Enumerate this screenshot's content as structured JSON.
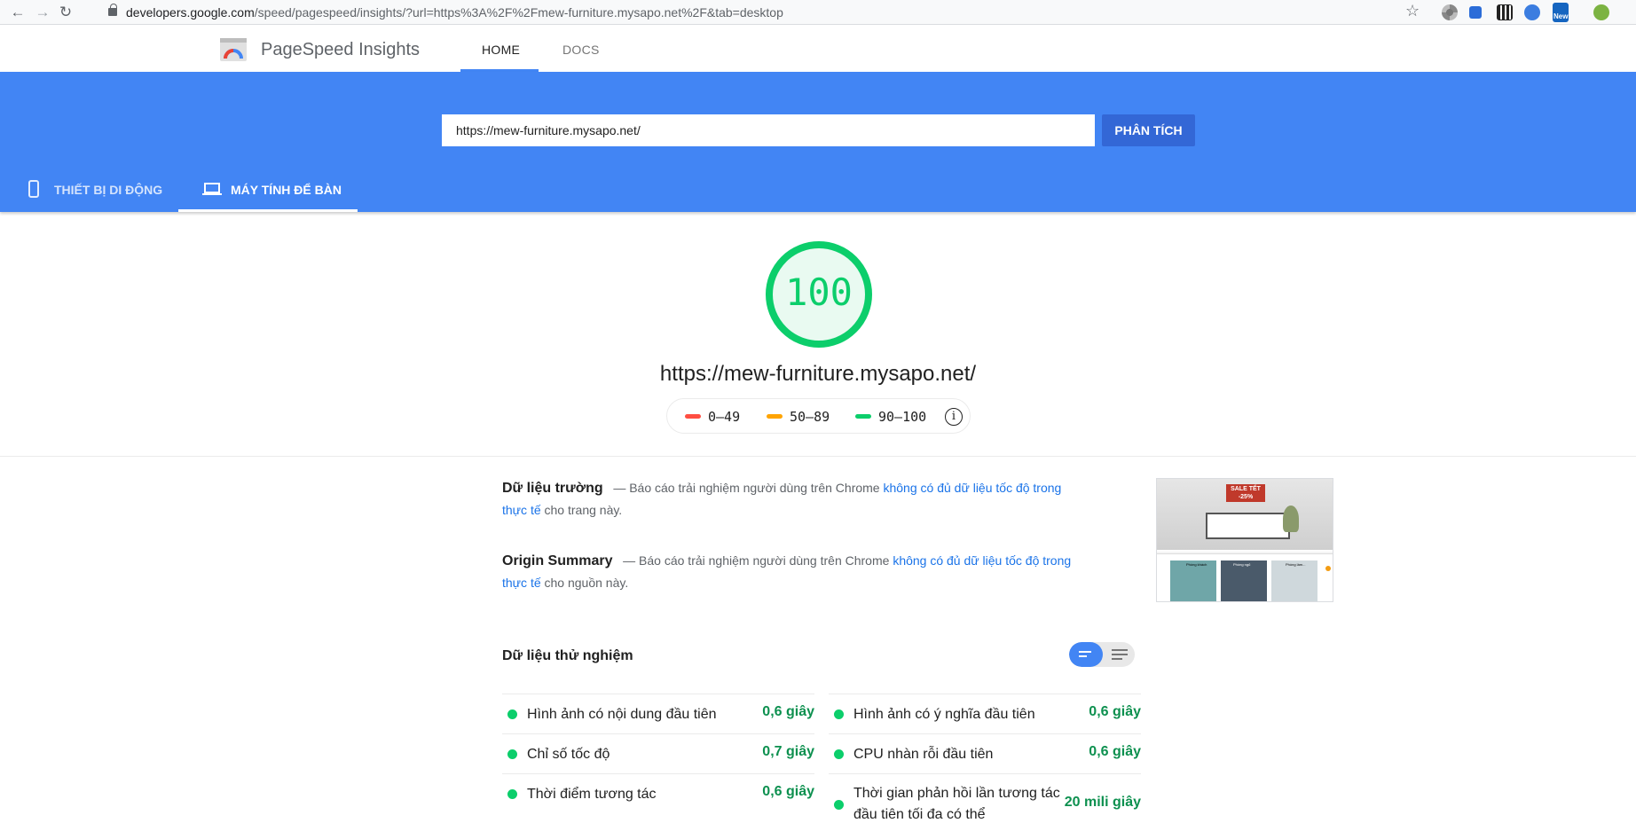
{
  "browser": {
    "url_host": "developers.google.com",
    "url_rest": "/speed/pagespeed/insights/?url=https%3A%2F%2Fmew-furniture.mysapo.net%2F&tab=desktop",
    "extension_badge": "New"
  },
  "header": {
    "app_title": "PageSpeed Insights",
    "tabs": [
      {
        "label": "HOME"
      },
      {
        "label": "DOCS"
      }
    ]
  },
  "search": {
    "value": "https://mew-furniture.mysapo.net/",
    "button_label": "PHÂN TÍCH"
  },
  "device_tabs": [
    {
      "label": "THIẾT BỊ DI ĐỘNG"
    },
    {
      "label": "MÁY TÍNH ĐỂ BÀN"
    }
  ],
  "score": {
    "value": "100",
    "percent": 100,
    "tested_url": "https://mew-furniture.mysapo.net/",
    "color": "#0cce6b"
  },
  "legend": [
    {
      "range": "0–49",
      "color": "#ff4e42"
    },
    {
      "range": "50–89",
      "color": "#ffa400"
    },
    {
      "range": "90–100",
      "color": "#0cce6b"
    }
  ],
  "field_data": {
    "title": "Dữ liệu trường",
    "prefix": "— Báo cáo trải nghiệm người dùng trên Chrome",
    "link": "không có đủ dữ liệu tốc độ trong thực tế",
    "suffix": "cho trang này."
  },
  "origin_summary": {
    "title": "Origin Summary",
    "prefix": "— Báo cáo trải nghiệm người dùng trên Chrome",
    "link": "không có đủ dữ liệu tốc độ trong thực tế",
    "suffix": "cho nguồn này."
  },
  "thumbnail": {
    "banner": "SALE TẾT",
    "banner_sub": "-25%",
    "cards": [
      "Phòng khách",
      "Phòng ngủ",
      "Phòng làm..."
    ]
  },
  "lab_data": {
    "title": "Dữ liệu thử nghiệm",
    "left": [
      {
        "label": "Hình ảnh có nội dung đầu tiên",
        "value": "0,6 giây"
      },
      {
        "label": "Chỉ số tốc độ",
        "value": "0,7 giây"
      },
      {
        "label": "Thời điểm tương tác",
        "value": "0,6 giây"
      }
    ],
    "right": [
      {
        "label": "Hình ảnh có ý nghĩa đầu tiên",
        "value": "0,6 giây"
      },
      {
        "label": "CPU nhàn rỗi đầu tiên",
        "value": "0,6 giây"
      },
      {
        "label": "Thời gian phản hồi lần tương tác đầu tiên tối đa có thể",
        "value": "20 mili giây"
      }
    ]
  }
}
